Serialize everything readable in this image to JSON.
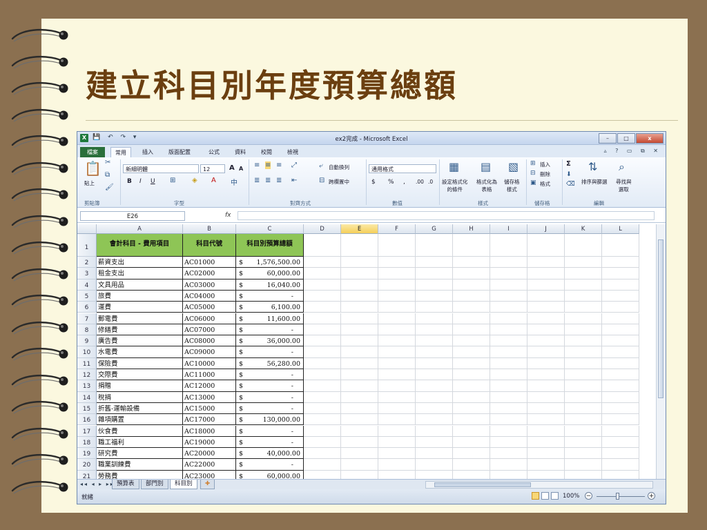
{
  "slide": {
    "title": "建立科目別年度預算總額"
  },
  "window": {
    "title": "ex2完成 - Microsoft Excel",
    "minimize": "–",
    "restore": "□",
    "close": "x"
  },
  "qat": {
    "icons": "💾 ↶ ↷ ▾"
  },
  "ribbon_tabs": [
    {
      "label": "檔案"
    },
    {
      "label": "常用"
    },
    {
      "label": "插入"
    },
    {
      "label": "版面配置"
    },
    {
      "label": "公式"
    },
    {
      "label": "資料"
    },
    {
      "label": "校閱"
    },
    {
      "label": "檢視"
    }
  ],
  "ribbon": {
    "clipboard": {
      "paste_label": "貼上",
      "group": "剪貼簿"
    },
    "font": {
      "name": "新細明體",
      "size": "12",
      "bold": "B",
      "italic": "I",
      "underline": "U",
      "grow": "A",
      "shrink": "A",
      "group": "字型"
    },
    "alignment": {
      "wrap": "自動換列",
      "merge": "跨欄置中",
      "group": "對齊方式"
    },
    "number": {
      "format": "通用格式",
      "currency": "$",
      "percent": "%",
      "comma": ",",
      "inc": ".00",
      "dec": ".0",
      "group": "數值"
    },
    "styles": {
      "conditional": "設定格式化\n的條件",
      "table": "格式化為\n表格",
      "cell": "儲存格\n樣式",
      "group": "樣式"
    },
    "cells": {
      "insert": "插入",
      "delete": "刪除",
      "format": "格式",
      "group": "儲存格"
    },
    "editing": {
      "sum": "Σ",
      "sort": "排序與篩選",
      "find": "尋找與\n選取",
      "group": "編輯"
    }
  },
  "formula_bar": {
    "name_box": "E26",
    "fx": "fx",
    "formula": ""
  },
  "columns": [
    "A",
    "B",
    "C",
    "D",
    "E",
    "F",
    "G",
    "H",
    "I",
    "J",
    "K",
    "L"
  ],
  "selected_column": "E",
  "table": {
    "headers": [
      "會計科目 - 費用項目",
      "科目代號",
      "科目別預算總額"
    ],
    "currency_symbol": "$",
    "rows": [
      {
        "n": "2",
        "item": "薪資支出",
        "code": "AC01000",
        "amount": "1,576,500.00"
      },
      {
        "n": "3",
        "item": "租金支出",
        "code": "AC02000",
        "amount": "60,000.00"
      },
      {
        "n": "4",
        "item": "文具用品",
        "code": "AC03000",
        "amount": "16,040.00"
      },
      {
        "n": "5",
        "item": "旅費",
        "code": "AC04000",
        "amount": "-"
      },
      {
        "n": "6",
        "item": "運費",
        "code": "AC05000",
        "amount": "6,100.00"
      },
      {
        "n": "7",
        "item": "郵電費",
        "code": "AC06000",
        "amount": "11,600.00"
      },
      {
        "n": "8",
        "item": "修繕費",
        "code": "AC07000",
        "amount": "-"
      },
      {
        "n": "9",
        "item": "廣告費",
        "code": "AC08000",
        "amount": "36,000.00"
      },
      {
        "n": "10",
        "item": "水電費",
        "code": "AC09000",
        "amount": "-"
      },
      {
        "n": "11",
        "item": "保險費",
        "code": "AC10000",
        "amount": "56,280.00"
      },
      {
        "n": "12",
        "item": "交際費",
        "code": "AC11000",
        "amount": "-"
      },
      {
        "n": "13",
        "item": "捐贈",
        "code": "AC12000",
        "amount": "-"
      },
      {
        "n": "14",
        "item": "稅捐",
        "code": "AC13000",
        "amount": "-"
      },
      {
        "n": "15",
        "item": "折舊-運輸設備",
        "code": "AC15000",
        "amount": "-"
      },
      {
        "n": "16",
        "item": "雜項購置",
        "code": "AC17000",
        "amount": "130,000.00"
      },
      {
        "n": "17",
        "item": "伙食費",
        "code": "AC18000",
        "amount": "-"
      },
      {
        "n": "18",
        "item": "職工福利",
        "code": "AC19000",
        "amount": "-"
      },
      {
        "n": "19",
        "item": "研究費",
        "code": "AC20000",
        "amount": "40,000.00"
      },
      {
        "n": "20",
        "item": "職業訓練費",
        "code": "AC22000",
        "amount": "-"
      },
      {
        "n": "21",
        "item": "勞務費",
        "code": "AC23000",
        "amount": "60,000.00"
      }
    ]
  },
  "sheet_tabs": [
    {
      "label": "預算表"
    },
    {
      "label": "部門別"
    },
    {
      "label": "科目別"
    }
  ],
  "active_sheet": "科目別",
  "status": {
    "ready": "就緒",
    "zoom": "100%"
  },
  "colors": {
    "header_fill": "#8ec556",
    "file_tab": "#2a6f3a",
    "title": "#6b3f10",
    "selected_col": "#f5cf5a"
  }
}
